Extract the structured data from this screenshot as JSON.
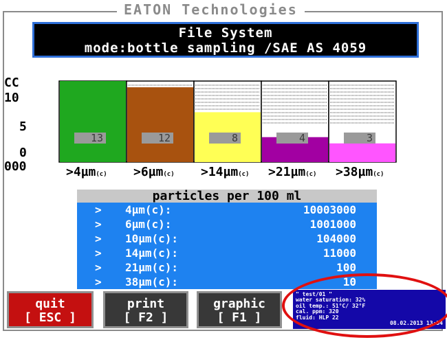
{
  "app_title": "EATON Technologies",
  "header": {
    "title": "File System",
    "mode": "mode:bottle sampling /SAE AS 4059"
  },
  "chart_data": {
    "type": "bar",
    "ylabel": "CC",
    "yticks": [
      "10",
      "5",
      "0",
      "000"
    ],
    "categories": [
      ">4µm(c)",
      ">6µm(c)",
      ">14µm(c)",
      ">21µm(c)",
      ">38µm(c)"
    ],
    "category_main": [
      ">4µm",
      ">6µm",
      ">14µm",
      ">21µm",
      ">38µm"
    ],
    "category_sub": "(c)",
    "values": [
      13,
      12,
      8,
      4,
      3
    ],
    "labels": [
      "13",
      "12",
      "8",
      "4",
      "3"
    ],
    "colors": [
      "#1fa81f",
      "#a8520f",
      "#ffff55",
      "#a200a2",
      "#ff55ff"
    ],
    "ylim": [
      0,
      13
    ]
  },
  "table": {
    "header": "particles per 100 ml",
    "rows": [
      {
        "arrow": ">",
        "size": "4µm(c):",
        "value": "10003000"
      },
      {
        "arrow": ">",
        "size": "6µm(c):",
        "value": "1001000"
      },
      {
        "arrow": ">",
        "size": "10µm(c):",
        "value": "104000"
      },
      {
        "arrow": ">",
        "size": "14µm(c):",
        "value": "11000"
      },
      {
        "arrow": ">",
        "size": "21µm(c):",
        "value": "100"
      },
      {
        "arrow": ">",
        "size": "38µm(c):",
        "value": "10"
      }
    ]
  },
  "buttons": {
    "quit": {
      "label": "quit",
      "key": "[ ESC ]"
    },
    "print": {
      "label": "print",
      "key": "[ F2 ]"
    },
    "graphic": {
      "label": "graphic",
      "key": "[ F1 ]"
    }
  },
  "status": {
    "test": "\" test/01 \"",
    "water": "water saturation: 32%",
    "oil": "oil temp.: 51°C/   32°F",
    "cal": "cal. ppm: 320",
    "fluid": "fluid: HLP 22",
    "timestamp": "08.02.2013 13:54"
  },
  "highlight_color": "#e01010"
}
